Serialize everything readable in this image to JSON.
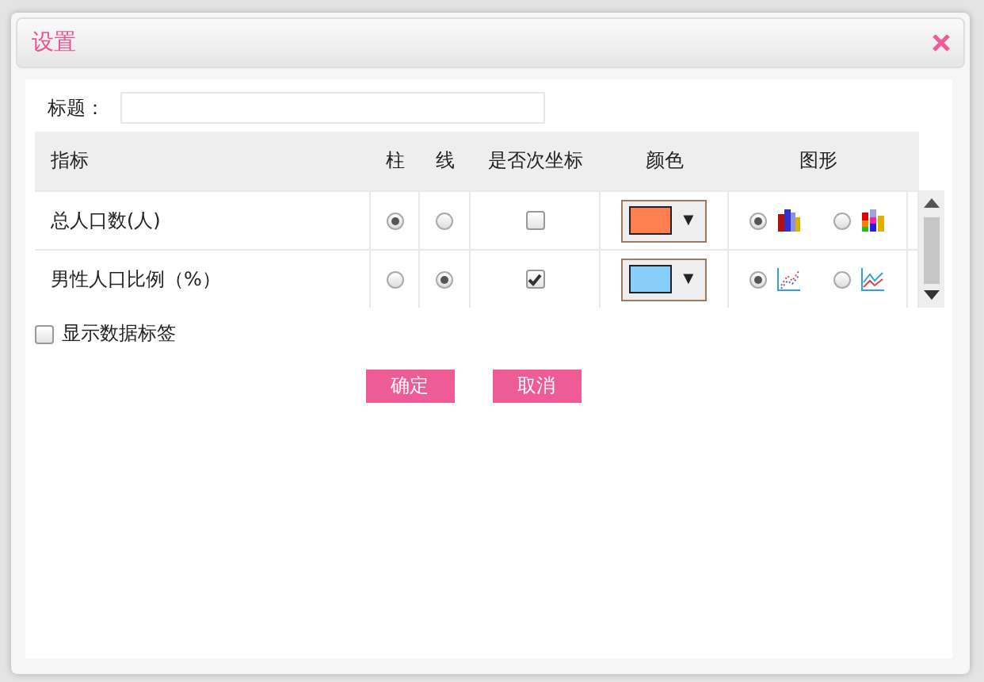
{
  "dialog": {
    "title": "设置"
  },
  "title_field": {
    "label": "标题："
  },
  "table": {
    "columns": [
      "指标",
      "柱",
      "线",
      "是否次坐标",
      "颜色",
      "图形"
    ],
    "rows": [
      {
        "name": "总人口数(人)",
        "bar_selected": true,
        "line_selected": false,
        "secondary_axis": false,
        "color": "#ff7f50",
        "dropdown": "▼",
        "shapes": [
          {
            "kind": "bar",
            "selected": true
          },
          {
            "kind": "stacked-bar",
            "selected": false
          }
        ]
      },
      {
        "name": "男性人口比例（%）",
        "bar_selected": false,
        "line_selected": true,
        "secondary_axis": true,
        "color": "#87cefa",
        "dropdown": "▼",
        "shapes": [
          {
            "kind": "scatter-line",
            "selected": true
          },
          {
            "kind": "line",
            "selected": false
          }
        ]
      }
    ]
  },
  "show_data_labels": {
    "label": "显示数据标签",
    "checked": false
  },
  "buttons": [
    "确定",
    "取消"
  ]
}
